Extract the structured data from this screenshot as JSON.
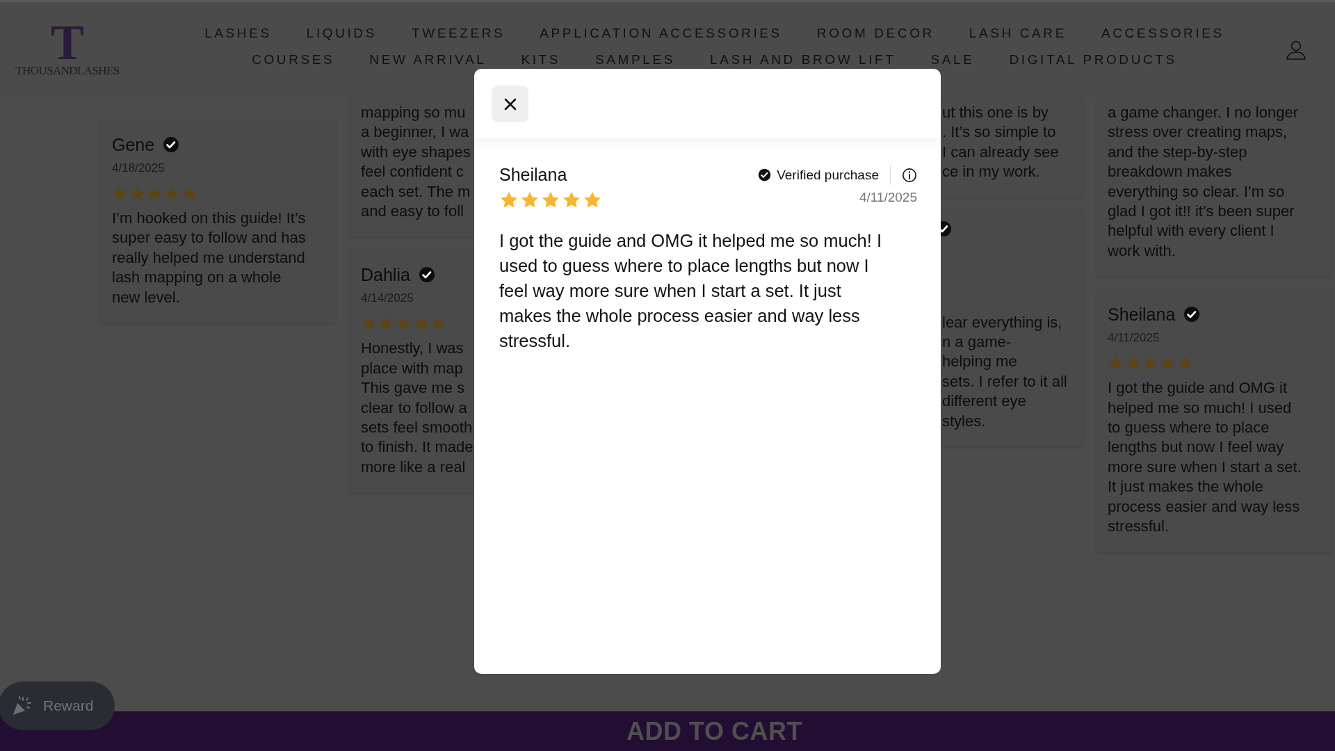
{
  "header": {
    "logo": {
      "mark": "T",
      "name": "THOUSANDLASHES"
    },
    "nav_rows": [
      [
        "LASHES",
        "LIQUIDS",
        "TWEEZERS",
        "APPLICATION ACCESSORIES",
        "ROOM DECOR",
        "LASH CARE",
        "ACCESSORIES"
      ],
      [
        "COURSES",
        "NEW ARRIVAL",
        "KITS",
        "SAMPLES",
        "LASH AND BROW LIFT",
        "SALE",
        "DIGITAL PRODUCTS"
      ]
    ]
  },
  "review_columns": [
    [
      {
        "name": "Gene",
        "verified": true,
        "date": "4/18/2025",
        "stars": 5,
        "text": "I’m hooked on this guide! It’s super easy to follow and has really helped me understand lash mapping on a whole new level."
      }
    ],
    [
      {
        "lines": [
          "mapping so mu",
          "a beginner, I wa",
          "with eye shapes",
          "feel confident c",
          "each set. The m",
          "and easy to foll"
        ]
      },
      {
        "name": "Dahlia",
        "verified": true,
        "date": "4/14/2025",
        "stars": 5,
        "lines": [
          "Honestly, I was",
          "place with map",
          "This gave me s",
          "clear to follow a",
          "sets feel smooth",
          "to finish. It made",
          "more like a real"
        ]
      }
    ],
    [
      {
        "lines": [
          "ut this one is by",
          ". It’s so simple to",
          "I can already see",
          "ce in my work."
        ]
      },
      {
        "verified": true,
        "lines": [
          "lear everything is,",
          "n a game-",
          "helping me",
          "sets. I refer to it all",
          "different eye",
          "styles."
        ]
      }
    ],
    [
      {
        "lines": [
          "a game changer. I no longer",
          "stress over creating maps,",
          "and the step-by-step",
          "breakdown makes",
          "everything so clear. I’m so",
          "glad I got it!! it’s been super",
          "helpful with every client I",
          "work with."
        ]
      },
      {
        "name": "Sheilana",
        "verified": true,
        "date": "4/11/2025",
        "stars": 5,
        "lines": [
          "I got the guide and OMG it",
          "helped me so much! I used",
          "to guess where to place",
          "lengths but now I feel way",
          "more sure when I start a set.",
          "It just makes the whole",
          "process easier and way less",
          "stressful."
        ]
      }
    ]
  ],
  "modal": {
    "name": "Sheilana",
    "verified_label": "Verified purchase",
    "stars": 5,
    "date": "4/11/2025",
    "text": "I got the guide and OMG it helped me so much! I used to guess where to place lengths but now I feel way more sure when I start a set. It just makes the whole process easier and way less stressful."
  },
  "reward_button": {
    "label": "Reward"
  },
  "add_to_cart": {
    "label": "ADD TO CART"
  }
}
